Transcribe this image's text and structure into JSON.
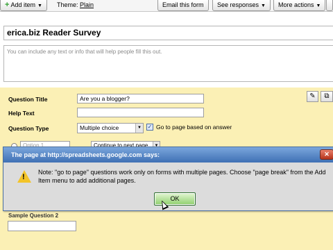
{
  "toolbar": {
    "add_item": "Add item",
    "theme": "Theme:",
    "theme_value": "Plain",
    "email_form": "Email this form",
    "see_responses": "See responses",
    "more_actions": "More actions",
    "dropdown_glyph": "▼"
  },
  "form": {
    "title": "erica.biz Reader Survey",
    "description_placeholder": "You can include any text or info that will help people fill this out."
  },
  "question": {
    "title_label": "Question Title",
    "title_value": "Are you a blogger?",
    "help_label": "Help Text",
    "help_value": "",
    "type_label": "Question Type",
    "type_value": "Multiple choice",
    "goto_checkbox_label": "Go to page based on answer",
    "goto_checked": true,
    "option_placeholder": "Option 1",
    "option_goto_value": "Continue to next page",
    "sample_label": "Sample Question 2"
  },
  "dialog": {
    "title": "The page at http://spreadsheets.google.com says:",
    "message": "Note: \"go to page\" questions work only on forms with multiple pages. Choose \"page break\" from the Add Item menu to add additional pages.",
    "ok_label": "OK",
    "close_glyph": "✕",
    "icon": "warning-icon"
  },
  "colors": {
    "question_panel": "#fbf0b5",
    "dialog_title_bar": "#3f70b4",
    "ok_button": "#8fcf6c"
  }
}
